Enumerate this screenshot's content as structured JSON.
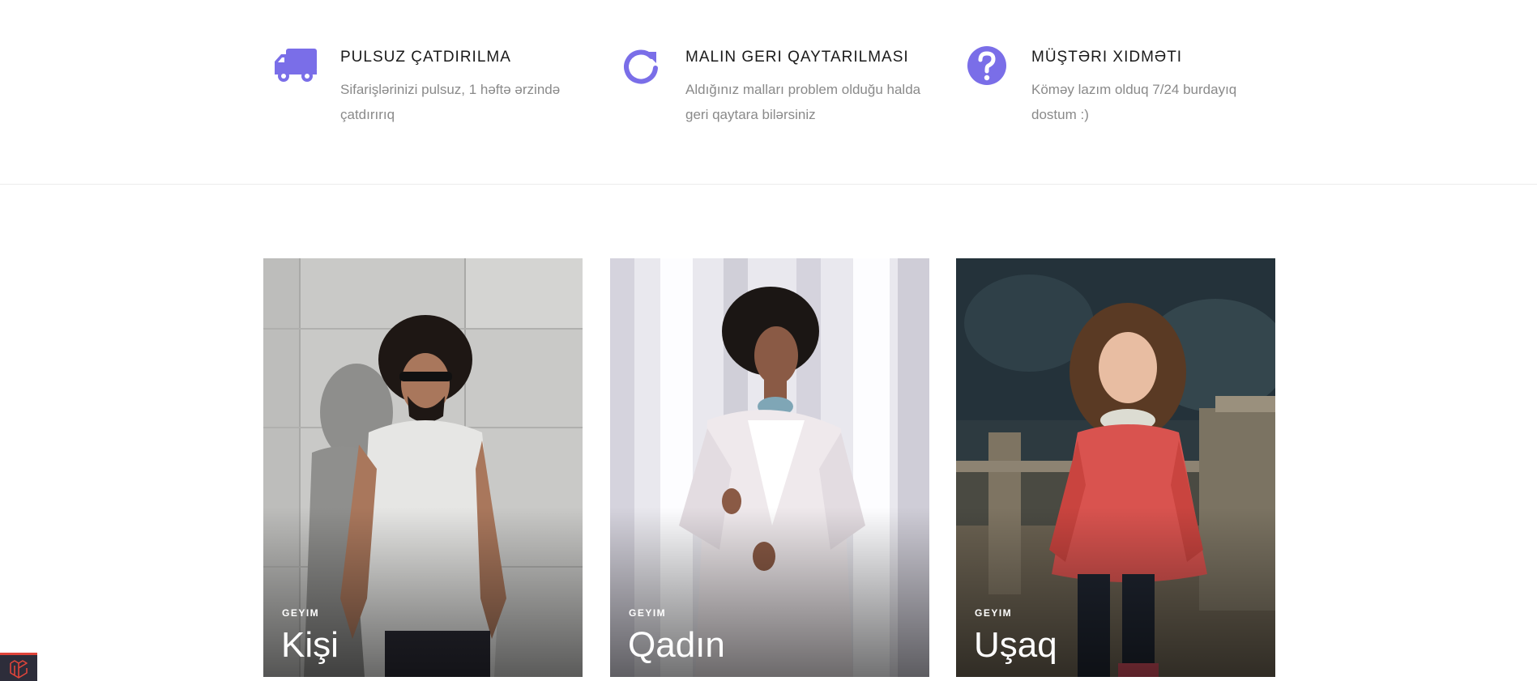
{
  "features": [
    {
      "icon": "truck-icon",
      "title": "PULSUZ ÇATDIRILMA",
      "description": "Sifarişlərinizi pulsuz, 1 həftə ərzində çatdırırıq"
    },
    {
      "icon": "refresh-icon",
      "title": "MALIN GERI QAYTARILMASI",
      "description": "Aldığınız malları problem olduğu halda geri qaytara bilərsiniz"
    },
    {
      "icon": "question-icon",
      "title": "MÜŞTƏRI XIDMƏTI",
      "description": "Köməy lazım olduq 7/24 burdayıq dostum :)"
    }
  ],
  "categories": [
    {
      "tag": "GEYIM",
      "name": "Kişi",
      "image": "man-photo"
    },
    {
      "tag": "GEYIM",
      "name": "Qadın",
      "image": "woman-photo"
    },
    {
      "tag": "GEYIM",
      "name": "Uşaq",
      "image": "child-photo"
    }
  ],
  "colors": {
    "accent": "#7a6ee8",
    "feature_text": "#8a8a8a"
  }
}
